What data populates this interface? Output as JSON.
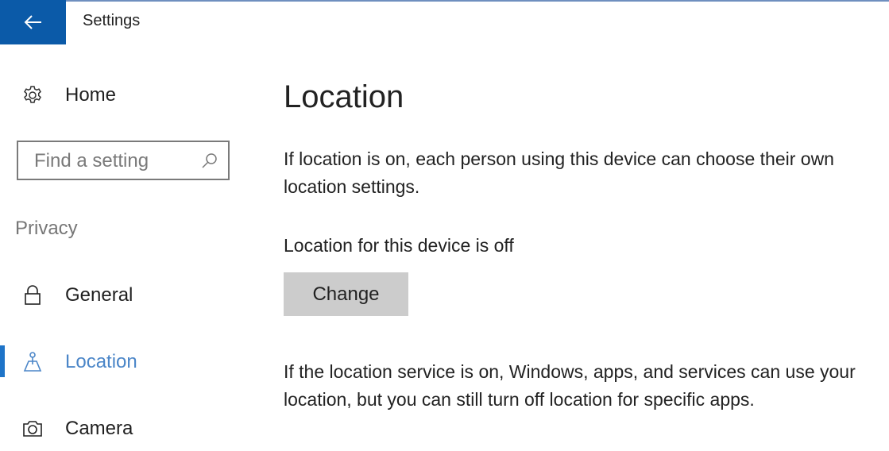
{
  "window": {
    "title": "Settings",
    "back_icon": "arrow-left-icon",
    "accent_color": "#0b5aa8"
  },
  "sidebar": {
    "home": {
      "label": "Home",
      "icon": "gear-icon"
    },
    "search": {
      "placeholder": "Find a setting",
      "value": "",
      "icon": "search-icon"
    },
    "section_label": "Privacy",
    "items": [
      {
        "label": "General",
        "icon": "lock-icon",
        "active": false
      },
      {
        "label": "Location",
        "icon": "location-icon",
        "active": true
      },
      {
        "label": "Camera",
        "icon": "camera-icon",
        "active": false
      }
    ],
    "active_color": "#4b86c8"
  },
  "main": {
    "title": "Location",
    "intro": "If location is on, each person using this device can choose their own location settings.",
    "device_status": "Location for this device is off",
    "change_button": "Change",
    "service_description": "If the location service is on, Windows, apps, and services can use your location, but you can still turn off location for specific apps."
  }
}
